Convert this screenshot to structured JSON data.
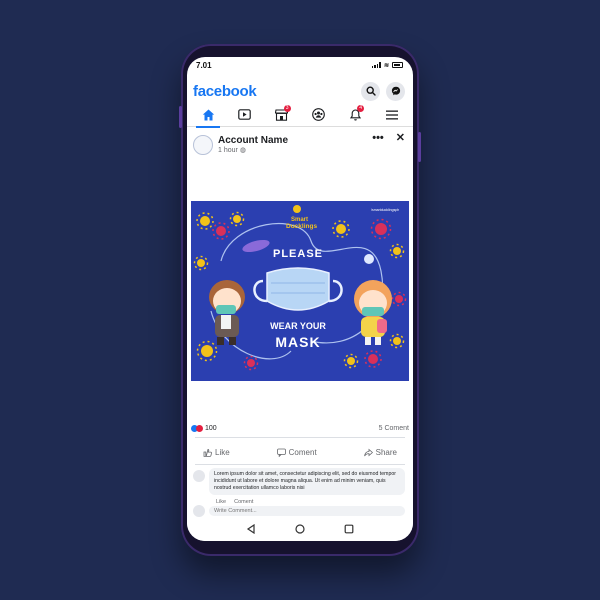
{
  "status_bar": {
    "time": "7.01"
  },
  "header": {
    "logo": "facebook"
  },
  "nav_tabs": [
    {
      "name": "home",
      "active": true
    },
    {
      "name": "watch",
      "active": false
    },
    {
      "name": "marketplace",
      "badge": "3"
    },
    {
      "name": "groups",
      "active": false
    },
    {
      "name": "notifications",
      "badge": "4"
    },
    {
      "name": "menu",
      "active": false
    }
  ],
  "post": {
    "account_name": "Account Name",
    "time": "1 hour",
    "image": {
      "brand_line1": "Smart",
      "brand_line2": "Ducklings",
      "headline_line1": "PLEASE",
      "headline_line2": "WEAR YOUR",
      "headline_line3": "MASK",
      "social_handle": "/smartducklingsph",
      "colors": {
        "background": "#2b3fb0",
        "virus": "#f2c21a",
        "virus_alt": "#d9305a"
      }
    },
    "reactions_count": "100",
    "comments_count": "5 Coment",
    "actions": {
      "like": "Like",
      "comment": "Coment",
      "share": "Share"
    },
    "comment": {
      "text": "Lorem ipsum dolor sit amet, consectetur adipiscing elit, sed do eiusmod tempor incididunt ut labore et dolore magna aliqua. Ut enim ad minim veniam, quis nostrud exercitation ullamco laboris nisi",
      "like_link": "Like",
      "comment_link": "Coment"
    },
    "write_comment_placeholder": "Write Comment..."
  },
  "colors": {
    "brand": "#1877f2",
    "page_bg": "#1f2b52",
    "badge": "#e41e3f"
  }
}
